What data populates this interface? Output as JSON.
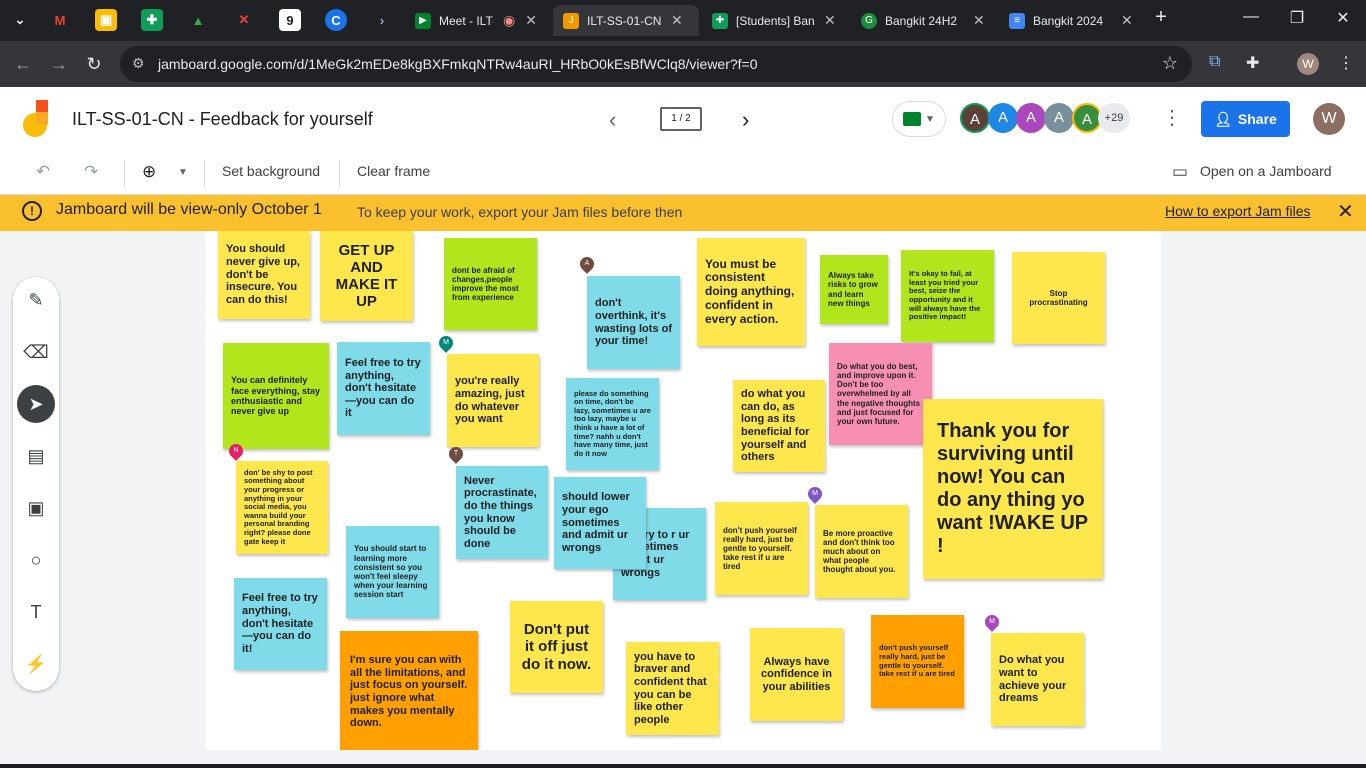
{
  "browser": {
    "tabs": [
      {
        "title": "Meet - ILT-"
      },
      {
        "title": "ILT-SS-01-CN"
      },
      {
        "title": "[Students] Ban"
      },
      {
        "title": "Bangkit 24H2"
      },
      {
        "title": "Bangkit 2024"
      }
    ],
    "url": "jamboard.google.com/d/1MeGk2mEDe8kgBXFmkqNTRw4auRI_HRbO0kEsBfWClq8/viewer?f=0",
    "profile_initial": "W"
  },
  "app": {
    "title": "ILT-SS-01-CN - Feedback for yourself",
    "frame_indicator": "1 / 2",
    "participants": [
      "A",
      "A",
      "A",
      "A",
      "A"
    ],
    "more_participants": "+29",
    "share_label": "Share",
    "user_initial": "W"
  },
  "toolbar": {
    "set_background": "Set background",
    "clear_frame": "Clear frame",
    "open_on_jamboard": "Open on a Jamboard"
  },
  "banner": {
    "title": "Jamboard will be view-only October 1",
    "subtitle": "To keep your work, export your Jam files before then",
    "link": "How to export Jam files"
  },
  "notes": [
    "You should never give up, don't be insecure. You can do this!",
    "GET UP AND MAKE IT UP",
    "dont be afraid of changes,people improve the most from experience",
    "don't overthink, it's wasting lots of your time!",
    "You must be consistent doing anything, confident in every action.",
    "Always take risks to grow and learn new things",
    "It's okay to fail, at least you tried your best, seize the opportunity and it will always have the positive impact!",
    "Stop procrastinating",
    "You can definitely face everything, stay enthusiastic and never give up",
    "Feel free to try anything, don't hesitate—you can do it",
    "you're really amazing, just do whatever you want",
    "please do something on time, don't be lazy, sometimes u are too lazy, maybe u think u have a lot of time? nahh u don't have many time, just do it now",
    "do what you can do, as long as its beneficial for yourself and others",
    "Do what you do best, and improve upon it. Don't be too overwhelmed by all the negative thoughts and just focused for your own future.",
    "Thank you for surviving until now! You can do any thing yo want !WAKE UP !",
    "don' be shy to post something about your progress or anything in your social media, you wanna build your personal branding right? please done gate keep it",
    "Never procrastinate, do the things you know should be done",
    "should lower your ego sometimes and admit ur wrongs",
    "uld try to r ur ego etimes admit ur wrongs",
    "don't push yourself really hard, just be gentle to yourself. take rest if u are tired",
    "Be more proactive and don't think too much about on what people thought about you.",
    "You should start to learning more consistent so you won't feel sleepy when your learning session start",
    "Feel free to try anything, don't hesitate—you can do it!",
    "I'm sure you can with all the limitations, and just focus on yourself. just ignore what makes you mentally down.",
    "Don't put it off just do it now.",
    "you have to braver and confident that you can be like other people",
    "Always have confidence in your abilities",
    "don't push yourself really hard, just be gentle to yourself. take rest if u are tired",
    "Do what you want to achieve your dreams"
  ],
  "pins": [
    "A",
    "M",
    "N",
    "T",
    "M",
    "M"
  ]
}
